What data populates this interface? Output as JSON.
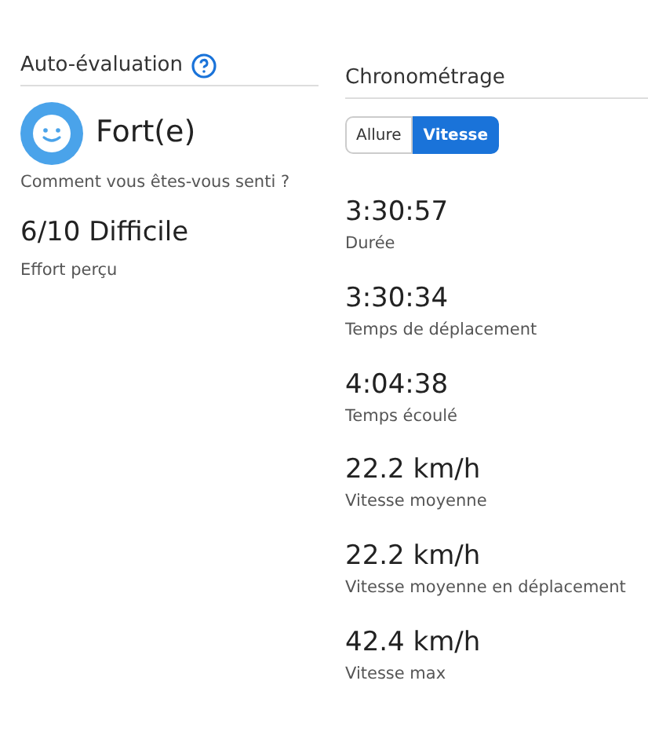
{
  "self_evaluation": {
    "title": "Auto-évaluation",
    "feeling": "Fort(e)",
    "feeling_label": "Comment vous êtes-vous senti ?",
    "effort": "6/10 Difficile",
    "effort_label": "Effort perçu"
  },
  "timing": {
    "title": "Chronométrage",
    "toggle": [
      {
        "label": "Allure",
        "selected": false
      },
      {
        "label": "Vitesse",
        "selected": true
      }
    ],
    "stats": [
      {
        "value": "3:30:57",
        "label": "Durée"
      },
      {
        "value": "3:30:34",
        "label": "Temps de déplacement"
      },
      {
        "value": "4:04:38",
        "label": "Temps écoulé"
      },
      {
        "value": "22.2 km/h",
        "label": "Vitesse moyenne"
      },
      {
        "value": "22.2 km/h",
        "label": "Vitesse moyenne en déplacement"
      },
      {
        "value": "42.4 km/h",
        "label": "Vitesse max"
      }
    ]
  }
}
